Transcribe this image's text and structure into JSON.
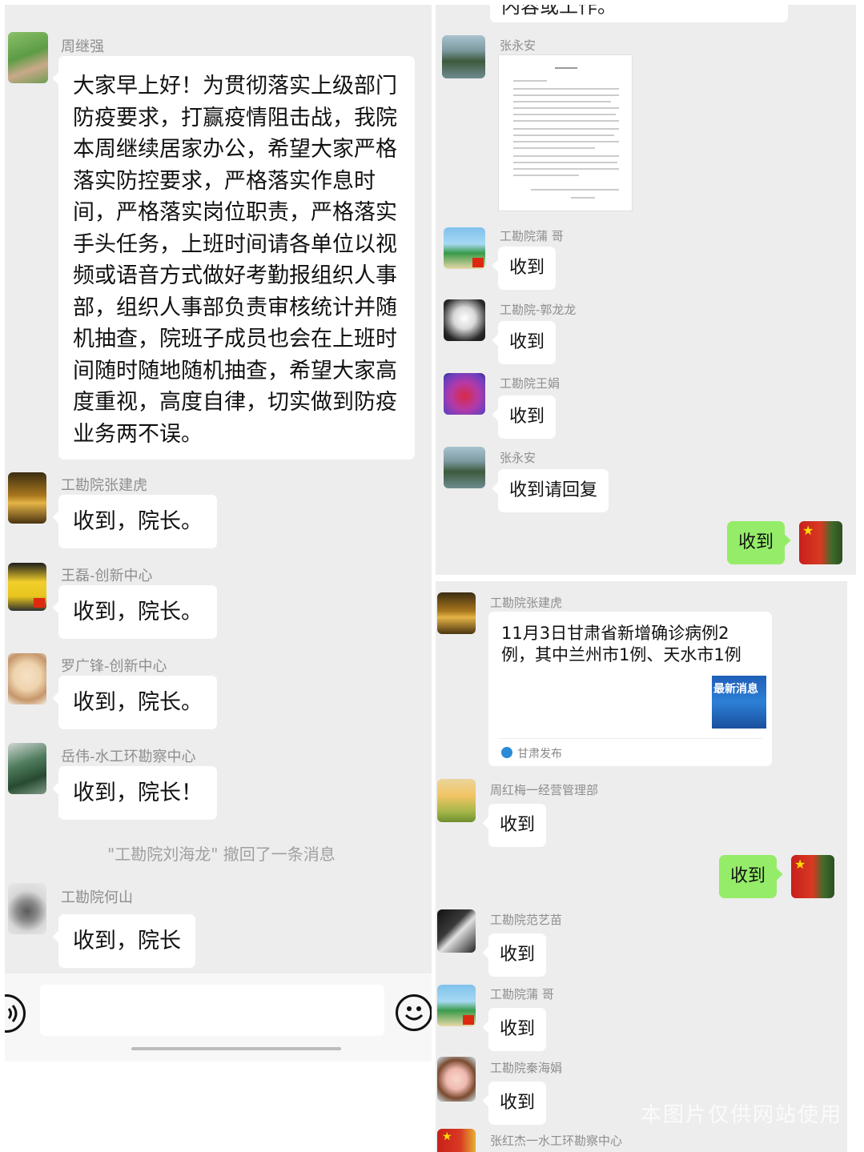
{
  "left": {
    "announcement": {
      "sender": "周继强",
      "lines": [
        "大家早上好！为贯彻落实上级部门",
        "防疫要求，打赢疫情阻击战，我院",
        "本周继续居家办公，希望大家严格",
        "落实防控要求，严格落实作息时",
        "间，严格落实岗位职责，严格落实",
        "手头任务，上班时间请各单位以视",
        "频或语音方式做好考勤报组织人事",
        "部，组织人事部负责审核统计并随",
        "机抽查，院班子成员也会在上班时",
        "间随时随地随机抽查，希望大家高",
        "度重视，高度自律，切实做到防疫",
        "业务两不误。"
      ]
    },
    "replies": [
      {
        "sender": "工勘院张建虎",
        "text": "收到，院长。"
      },
      {
        "sender": "王磊-创新中心",
        "text": "收到，院长。"
      },
      {
        "sender": "罗广锋-创新中心",
        "text": "收到，院长。"
      },
      {
        "sender": "岳伟-水工环勘察中心",
        "text": "收到，院长！"
      },
      {
        "sender": "工勘院何山",
        "text": "收到，院长"
      }
    ],
    "recall_notice": "\"工勘院刘海龙\" 撤回了一条消息",
    "input_bar": {
      "voice_icon": "voice-icon",
      "emoji_icon": "emoji-icon"
    }
  },
  "top_right": {
    "cut_off_text": "内容或工作。",
    "messages": [
      {
        "sender": "张永安",
        "type": "document"
      },
      {
        "sender": "工勘院蒲 哥",
        "text": "收到"
      },
      {
        "sender": "工勘院-郭龙龙",
        "text": "收到"
      },
      {
        "sender": "工勘院王娟",
        "text": "收到"
      },
      {
        "sender": "张永安",
        "text": "收到请回复"
      }
    ],
    "self_message": "收到"
  },
  "bottom_right": {
    "link_card": {
      "sender": "工勘院张建虎",
      "title_line1": "11月3日甘肃省新增确诊病例2",
      "title_line2": "例，其中兰州市1例、天水市1例",
      "thumb_text": "最新消息",
      "source": "甘肃发布"
    },
    "messages_before": [
      {
        "sender": "周红梅一经营管理部",
        "text": "收到"
      }
    ],
    "self_message": "收到",
    "messages_after": [
      {
        "sender": "工勘院范艺苗",
        "text": "收到"
      },
      {
        "sender": "工勘院蒲 哥",
        "text": "收到"
      },
      {
        "sender": "工勘院秦海娟",
        "text": "收到"
      }
    ],
    "last_sender": "张红杰一水工环勘察中心",
    "watermark": "本图片仅供网站使用"
  },
  "colors": {
    "chat_bg": "#ededed",
    "bubble_bg": "#ffffff",
    "self_bubble_bg": "#95ec69",
    "name_text": "#8e8e8e"
  }
}
